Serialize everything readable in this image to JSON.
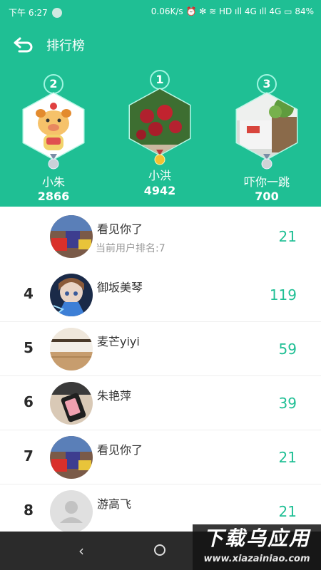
{
  "status_bar": {
    "time": "下午 6:27",
    "right": "0.06K/s ⏰ ✻ ≋ HD ıll 4G ıll 4G ▭ 84%"
  },
  "header": {
    "title": "排行榜"
  },
  "podium": [
    {
      "rank": "2",
      "name": "小朱",
      "score": "2866"
    },
    {
      "rank": "1",
      "name": "小洪",
      "score": "4942"
    },
    {
      "rank": "3",
      "name": "吓你一跳",
      "score": "700"
    }
  ],
  "current_user": {
    "name": "看见你了",
    "sub": "当前用户排名:7",
    "score": "21"
  },
  "rows": [
    {
      "rank": "4",
      "name": "御坂美琴",
      "score": "119"
    },
    {
      "rank": "5",
      "name": "麦芒yiyi",
      "score": "59"
    },
    {
      "rank": "6",
      "name": "朱艳萍",
      "score": "39"
    },
    {
      "rank": "7",
      "name": "看见你了",
      "score": "21"
    },
    {
      "rank": "8",
      "name": "游高飞",
      "score": "21"
    }
  ],
  "nav": {
    "back": "‹"
  },
  "watermark": {
    "big": "下载乌应用",
    "small": "www.xiazainiao.com"
  },
  "colors": {
    "accent": "#1fbf94",
    "score": "#1fbf94"
  }
}
